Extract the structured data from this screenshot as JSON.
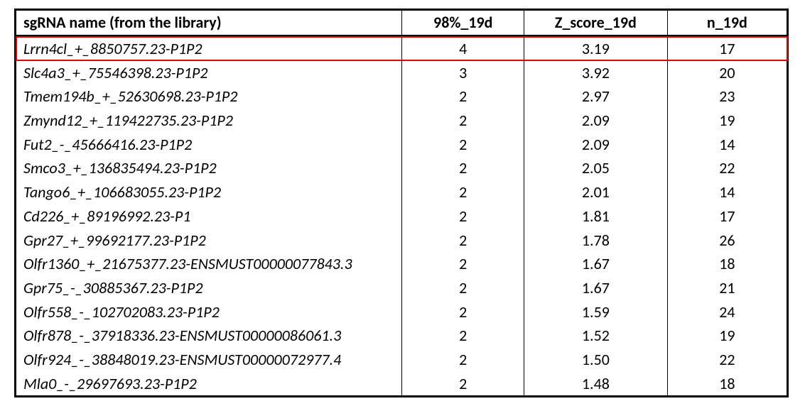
{
  "headers": {
    "name": "sgRNA name (from the library)",
    "c98": "98%_19d",
    "z": "Z_score_19d",
    "n": "n_19d"
  },
  "highlight_row_index": 0,
  "chart_data": {
    "type": "table",
    "title": "",
    "columns": [
      "sgRNA name (from the library)",
      "98%_19d",
      "Z_score_19d",
      "n_19d"
    ],
    "rows": [
      {
        "name": "Lrrn4cl_+_8850757.23-P1P2",
        "c98": 4,
        "z": "3.19",
        "n": 17
      },
      {
        "name": "Slc4a3_+_75546398.23-P1P2",
        "c98": 3,
        "z": "3.92",
        "n": 20
      },
      {
        "name": "Tmem194b_+_52630698.23-P1P2",
        "c98": 2,
        "z": "2.97",
        "n": 23
      },
      {
        "name": "Zmynd12_+_119422735.23-P1P2",
        "c98": 2,
        "z": "2.09",
        "n": 19
      },
      {
        "name": "Fut2_-_45666416.23-P1P2",
        "c98": 2,
        "z": "2.09",
        "n": 14
      },
      {
        "name": "Smco3_+_136835494.23-P1P2",
        "c98": 2,
        "z": "2.05",
        "n": 22
      },
      {
        "name": "Tango6_+_106683055.23-P1P2",
        "c98": 2,
        "z": "2.01",
        "n": 14
      },
      {
        "name": "Cd226_+_89196992.23-P1",
        "c98": 2,
        "z": "1.81",
        "n": 17
      },
      {
        "name": "Gpr27_+_99692177.23-P1P2",
        "c98": 2,
        "z": "1.78",
        "n": 26
      },
      {
        "name": "Olfr1360_+_21675377.23-ENSMUST00000077843.3",
        "c98": 2,
        "z": "1.67",
        "n": 18
      },
      {
        "name": "Gpr75_-_30885367.23-P1P2",
        "c98": 2,
        "z": "1.67",
        "n": 21
      },
      {
        "name": "Olfr558_-_102702083.23-P1P2",
        "c98": 2,
        "z": "1.59",
        "n": 24
      },
      {
        "name": "Olfr878_-_37918336.23-ENSMUST00000086061.3",
        "c98": 2,
        "z": "1.52",
        "n": 19
      },
      {
        "name": "Olfr924_-_38848019.23-ENSMUST00000072977.4",
        "c98": 2,
        "z": "1.50",
        "n": 22
      },
      {
        "name": "Mla0_-_29697693.23-P1P2",
        "c98": 2,
        "z": "1.48",
        "n": 18
      }
    ]
  }
}
